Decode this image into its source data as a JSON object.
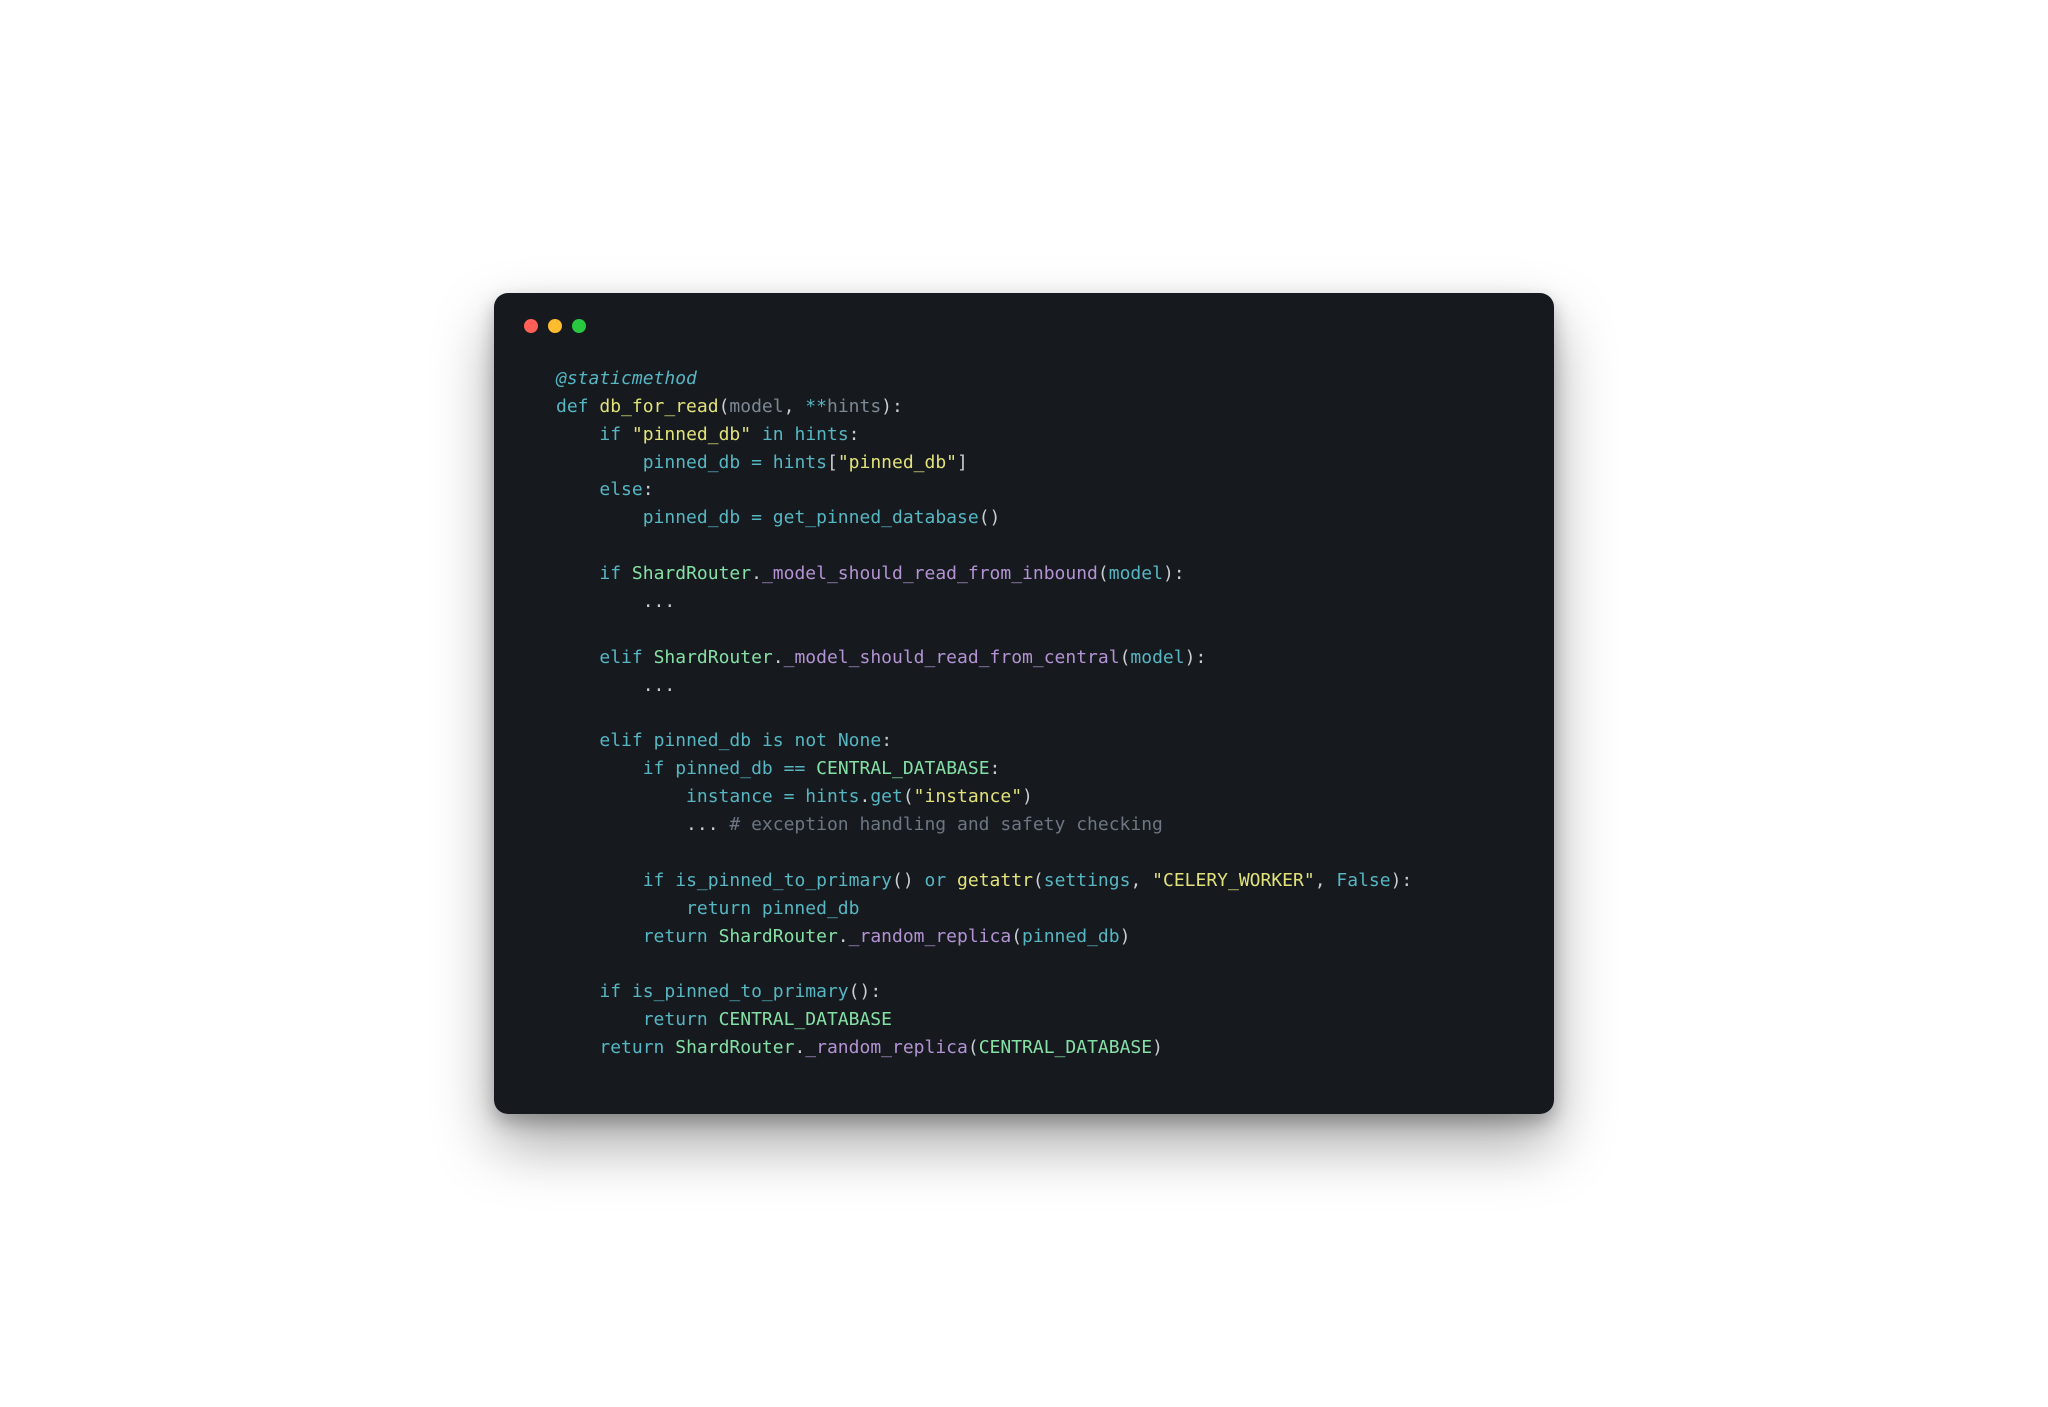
{
  "window": {
    "traffic_lights": {
      "close": "close",
      "minimize": "minimize",
      "zoom": "zoom"
    }
  },
  "code": {
    "decorator": "@staticmethod",
    "def": "def",
    "funcname": "db_for_read",
    "params_model": "model",
    "params_hints": "hints",
    "star_star": "**",
    "kw_if": "if",
    "kw_in": "in",
    "kw_else": "else",
    "kw_elif": "elif",
    "kw_is": "is",
    "kw_not": "not",
    "kw_or": "or",
    "kw_return": "return",
    "const_none": "None",
    "const_false": "False",
    "str_pinned_db": "\"pinned_db\"",
    "str_instance": "\"instance\"",
    "str_celery": "\"CELERY_WORKER\"",
    "id_hints": "hints",
    "id_pinned_db": "pinned_db",
    "id_model": "model",
    "id_instance": "instance",
    "id_settings": "settings",
    "fn_get_pinned_database": "get_pinned_database",
    "fn_is_pinned_to_primary": "is_pinned_to_primary",
    "fn_getattr": "getattr",
    "cls_ShardRouter": "ShardRouter",
    "mbr_inbound": "_model_should_read_from_inbound",
    "mbr_central": "_model_should_read_from_central",
    "mbr_random_replica": "_random_replica",
    "att_get": "get",
    "gbl_central_db": "CENTRAL_DATABASE",
    "ellipsis": "...",
    "comment_safety": "# exception handling and safety checking",
    "p_lparen": "(",
    "p_rparen": ")",
    "p_lbrack": "[",
    "p_rbrack": "]",
    "p_comma": ",",
    "p_colon": ":",
    "p_dot": ".",
    "p_eq": "=",
    "p_eqeq": "=="
  }
}
